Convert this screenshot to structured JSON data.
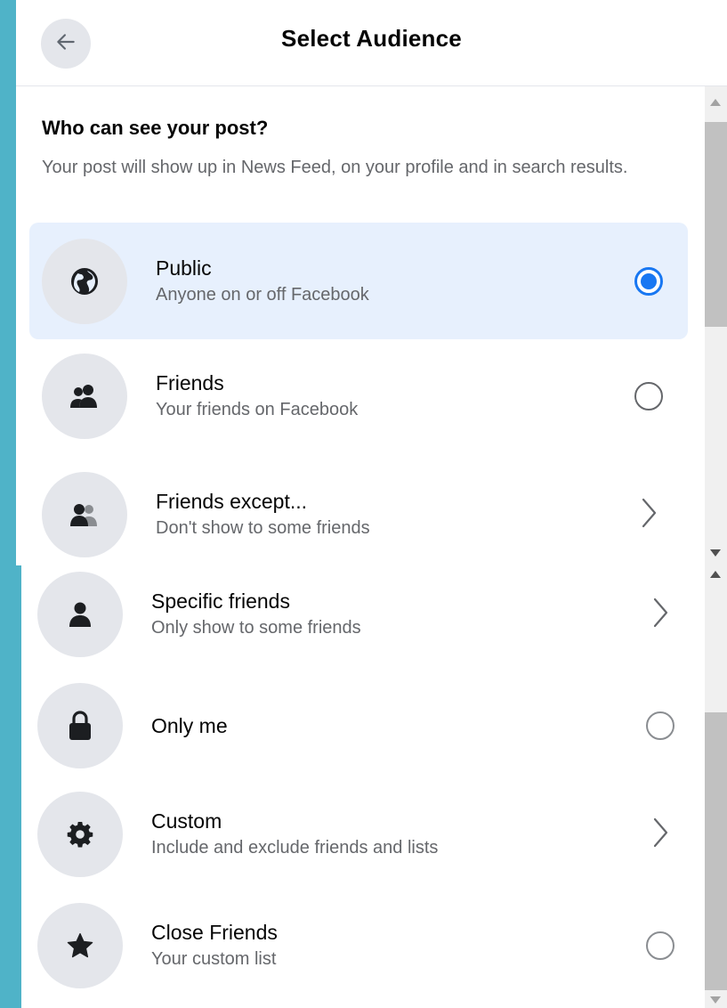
{
  "header": {
    "title": "Select Audience",
    "back_icon": "arrow-left-icon"
  },
  "intro": {
    "question": "Who can see your post?",
    "description": "Your post will show up in News Feed, on your profile and in search results."
  },
  "options": [
    {
      "title": "Public",
      "subtitle": "Anyone on or off Facebook",
      "icon": "globe-icon",
      "control": "radio",
      "selected": true
    },
    {
      "title": "Friends",
      "subtitle": "Your friends on Facebook",
      "icon": "friends-icon",
      "control": "radio",
      "selected": false
    },
    {
      "title": "Friends except...",
      "subtitle": "Don't show to some friends",
      "icon": "friends-except-icon",
      "control": "chevron",
      "selected": false
    },
    {
      "title": "Specific friends",
      "subtitle": "Only show to some friends",
      "icon": "person-icon",
      "control": "chevron",
      "selected": false
    },
    {
      "title": "Only me",
      "subtitle": "",
      "icon": "lock-icon",
      "control": "radio",
      "selected": false
    },
    {
      "title": "Custom",
      "subtitle": "Include and exclude friends and lists",
      "icon": "gear-icon",
      "control": "chevron",
      "selected": false
    },
    {
      "title": "Close Friends",
      "subtitle": "Your custom list",
      "icon": "star-icon",
      "control": "radio",
      "selected": false
    }
  ],
  "colors": {
    "accent": "#1877f2",
    "selected_bg": "#e7f0fd",
    "icon_circle": "#e4e6eb",
    "secondary_text": "#65676b",
    "background_frame": "#4fb3c8"
  }
}
